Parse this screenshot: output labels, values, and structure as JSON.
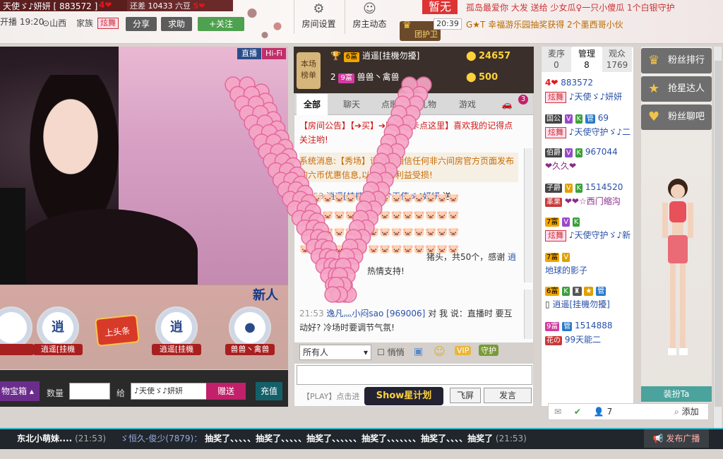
{
  "header": {
    "room_name": "天使ゞ♪妍妍",
    "room_id_prefix": "[ 883572 ]",
    "room_hearts": "4❤",
    "progress_label": "还差",
    "progress_value": "10433",
    "progress_unit": "六豆",
    "progress_hearts": "5❤",
    "live_time": "开播 19:20",
    "location": "山西",
    "family_label": "家族",
    "family_tag": "炫舞",
    "share_label": "分享",
    "help_label": "求助",
    "follow_label": "+关注",
    "room_settings_label": "房间设置",
    "host_feed_label": "房主动态",
    "guard_label": "团护卫",
    "gift_status": "暂无",
    "notice_line1": "孤岛最爱你 大发 送给 少女瓜♀一只小傻瓜 1个白银守护",
    "notice_time": "20:39",
    "notice_line2": "G★T 幸福游乐园抽奖获得 2个墨西哥小伙"
  },
  "video": {
    "live_badge": "直播",
    "hifi_badge": "Hi-Fi",
    "new_badge": "新人"
  },
  "gift_strip": {
    "items": [
      {
        "name": "逍遥[挂機"
      },
      {
        "name": "上头条"
      },
      {
        "name": "逍遥[挂機"
      },
      {
        "name": "兽兽丶禽兽"
      }
    ]
  },
  "gift_bar": {
    "box_label": "物宝箱",
    "qty_label": "数量",
    "to_label": "给",
    "target": "♪天使ゞ♪妍妍",
    "send_label": "赠送",
    "charge_label": "充值"
  },
  "rank": {
    "title_line1": "本场",
    "title_line2": "榜单",
    "rows": [
      {
        "rank": "1",
        "level": "6富",
        "name": "逍遥[挂機勿擾]",
        "coins": "24657"
      },
      {
        "rank": "2",
        "level": "9富",
        "name": "兽兽丶禽兽",
        "coins": "500"
      }
    ]
  },
  "chat": {
    "tabs": [
      "全部",
      "聊天",
      "点歌",
      "礼物",
      "游戏"
    ],
    "car_badge": "3",
    "room_notice": "【房间公告】【➔买】➔购买绿卡点这里】喜欢我的记得点关注哟!",
    "system_msg": "系统消息:【秀场】请不要相信任何非六间房官方页面发布的六币优惠信息,以免您的利益受损!",
    "gift_msg_time": "21:53",
    "gift_msg_from": "逍遥[挂機勿擾]",
    "gift_msg_to": "♪天使ゞ♪妍妍",
    "gift_msg_verb": "送",
    "gift_msg_tail": "猪头，共50个，感谢",
    "gift_msg_tail2": "逍",
    "gift_msg_support": "热情支持!",
    "pig_row": "🐷🐷🐷🐷🐷🐷🐷🐷🐷🐷🐷🐷🐷🐷",
    "chat_time": "21:53",
    "chat_from": "逸凡灬小闷sao [969006]",
    "chat_to": "我",
    "chat_text": "对 我 说：直播时 要互动好? 冷场时要调节气氛!",
    "audience_select": "所有人",
    "whisper_label": "悄悄",
    "play_hint": "【PLAY】点击进",
    "show_plan": "Show星计划",
    "fly_label": "飞屏",
    "speak_label": "发言"
  },
  "users": {
    "tabs": [
      {
        "label": "麦序",
        "count": "0"
      },
      {
        "label": "管理",
        "count": "8"
      },
      {
        "label": "观众",
        "count": "1769"
      }
    ],
    "rows": [
      {
        "badge": "4❤",
        "name": "883572",
        "tag": "炫舞",
        "sub": "♪天使ゞ♪妍妍"
      },
      {
        "badge": "国公",
        "name": "69",
        "tag": "炫舞",
        "sub": "♪天使守护ゞ♪二"
      },
      {
        "badge": "伯爵",
        "name": "967044",
        "sub": "❤久久❤"
      },
      {
        "badge": "子爵",
        "name": "1514520",
        "tag": "革果",
        "sub": "❤❤☆西门缩沟"
      },
      {
        "badge": "7富",
        "tag": "炫舞",
        "sub": "♪天使守护ゞ♪新"
      },
      {
        "badge": "7富",
        "sub": "地球的影子"
      },
      {
        "badge": "6富",
        "sub": "逍遥[挂機勿擾]"
      },
      {
        "badge": "9富",
        "name": "1514888",
        "tag": "花の",
        "sub": "99天能二"
      }
    ],
    "count_label": "7",
    "add_label": "添加"
  },
  "right_panel": {
    "fan_rank": "粉丝排行",
    "grab_star": "抢星达人",
    "fan_chat": "粉丝聊吧",
    "dress_up": "装扮Ta"
  },
  "bottom": {
    "msg1_user": "东北小萌妹....",
    "msg1_time": "(21:53)",
    "msg2_user": "ゞ恒久-俊少(7879)：",
    "msg2_text": "抽奖了、、、、、抽奖了、、、、、抽奖了、、、、、、抽奖了、、、、、、、抽奖了、、、、抽奖了",
    "msg2_time": "(21:53)",
    "broadcast_label": "发布广播"
  }
}
